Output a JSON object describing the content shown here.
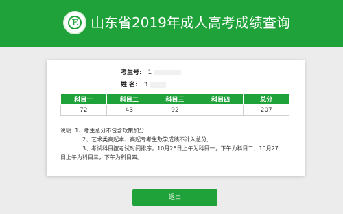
{
  "colors": {
    "brand": "#1fa23a",
    "background": "#ececec",
    "card": "#ffffff"
  },
  "header": {
    "title": "山东省2019年成人高考成绩查询",
    "logo_icon": "circle-e-emblem-icon"
  },
  "candidate": {
    "id_label": "考生号:",
    "id_value": "1",
    "name_label": "姓 名:",
    "name_value": "3"
  },
  "scores": {
    "headers": [
      "科目一",
      "科目二",
      "科目三",
      "科目四",
      "总分"
    ],
    "values": [
      "72",
      "43",
      "92",
      "",
      "207"
    ]
  },
  "notes": {
    "lines": [
      "说明: 1、考生总分不包含政策加分;",
      "2、艺术类高起本、高起专考生数学成绩不计入总分;",
      "3、考试科目按考试时间排序，10月26日上午为科目一，下午为科目二，10月27",
      "日上午为科目三，下午为科目四。"
    ]
  },
  "actions": {
    "exit_label": "退出"
  }
}
